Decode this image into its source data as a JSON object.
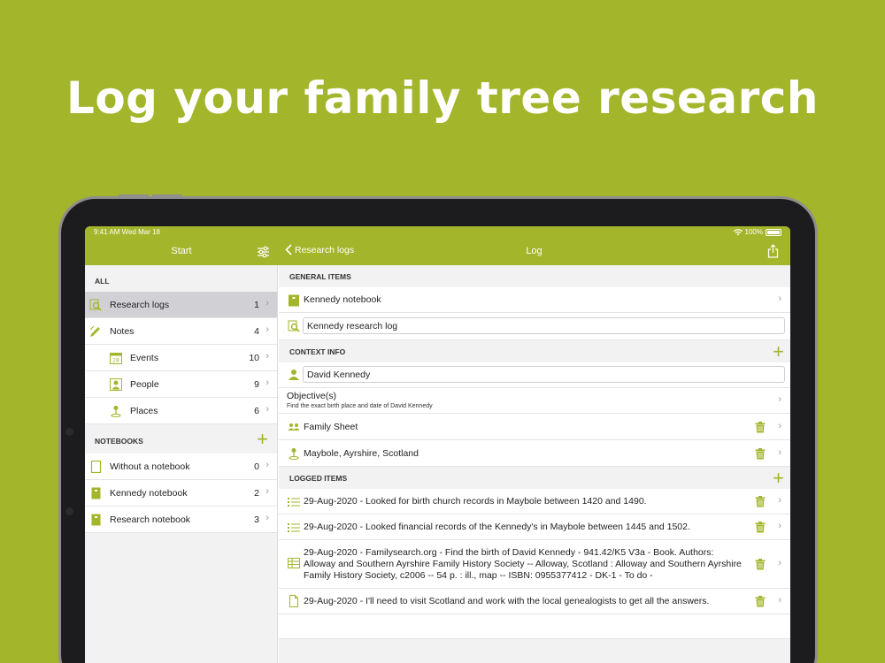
{
  "headline": "Log your family tree research",
  "status_bar": {
    "time_date": "9:41 AM   Wed Mar 18",
    "battery": "100%"
  },
  "left_nav": {
    "title": "Start"
  },
  "right_nav": {
    "back_label": "Research logs",
    "title": "Log"
  },
  "sidebar": {
    "all_header": "ALL",
    "all_items": [
      {
        "label": "Research logs",
        "count": "1",
        "icon": "magnifier-log-icon"
      },
      {
        "label": "Notes",
        "count": "4",
        "icon": "pencil-icon"
      },
      {
        "label": "Events",
        "count": "10",
        "icon": "calendar-icon"
      },
      {
        "label": "People",
        "count": "9",
        "icon": "person-icon"
      },
      {
        "label": "Places",
        "count": "6",
        "icon": "map-pin-icon"
      }
    ],
    "notebooks_header": "NOTEBOOKS",
    "notebooks": [
      {
        "label": "Without a notebook",
        "count": "0"
      },
      {
        "label": "Kennedy notebook",
        "count": "2"
      },
      {
        "label": "Research notebook",
        "count": "3"
      }
    ]
  },
  "detail": {
    "general_header": "GENERAL ITEMS",
    "notebook_name": "Kennedy notebook",
    "log_title_value": "Kennedy research log",
    "context_header": "CONTEXT INFO",
    "person_value": "David Kennedy",
    "objective_label": "Objective(s)",
    "objective_text": "Find the exact birth place and date of David Kennedy",
    "context_items": [
      {
        "label": "Family Sheet",
        "icon": "family-icon"
      },
      {
        "label": "Maybole, Ayrshire, Scotland",
        "icon": "map-pin-icon"
      }
    ],
    "logged_header": "LOGGED ITEMS",
    "logged_items": [
      {
        "text": "29-Aug-2020 - Looked for birth church records in Maybole between 1420 and 1490.",
        "icon": "list-icon"
      },
      {
        "text": "29-Aug-2020 - Looked financial records of the Kennedy's in Maybole between 1445 and 1502.",
        "icon": "list-icon"
      },
      {
        "text": "29-Aug-2020 - Familysearch.org - Find the birth of David Kennedy - 941.42/K5 V3a - Book. Authors: Alloway and Southern Ayrshire Family History Society -- Alloway, Scotland : Alloway and Southern Ayrshire Family History Society, c2006 -- 54 p. : ill., map -- ISBN: 0955377412 - DK-1 - To do -",
        "icon": "table-icon"
      },
      {
        "text": "29-Aug-2020 - I'll need to visit Scotland and work with the local genealogists to get all the answers.",
        "icon": "document-icon"
      }
    ]
  },
  "colors": {
    "accent": "#a3b52a",
    "background": "#a3b52a",
    "sidebar_bg": "#f2f2f3",
    "selected_row": "#d1d1d5"
  }
}
